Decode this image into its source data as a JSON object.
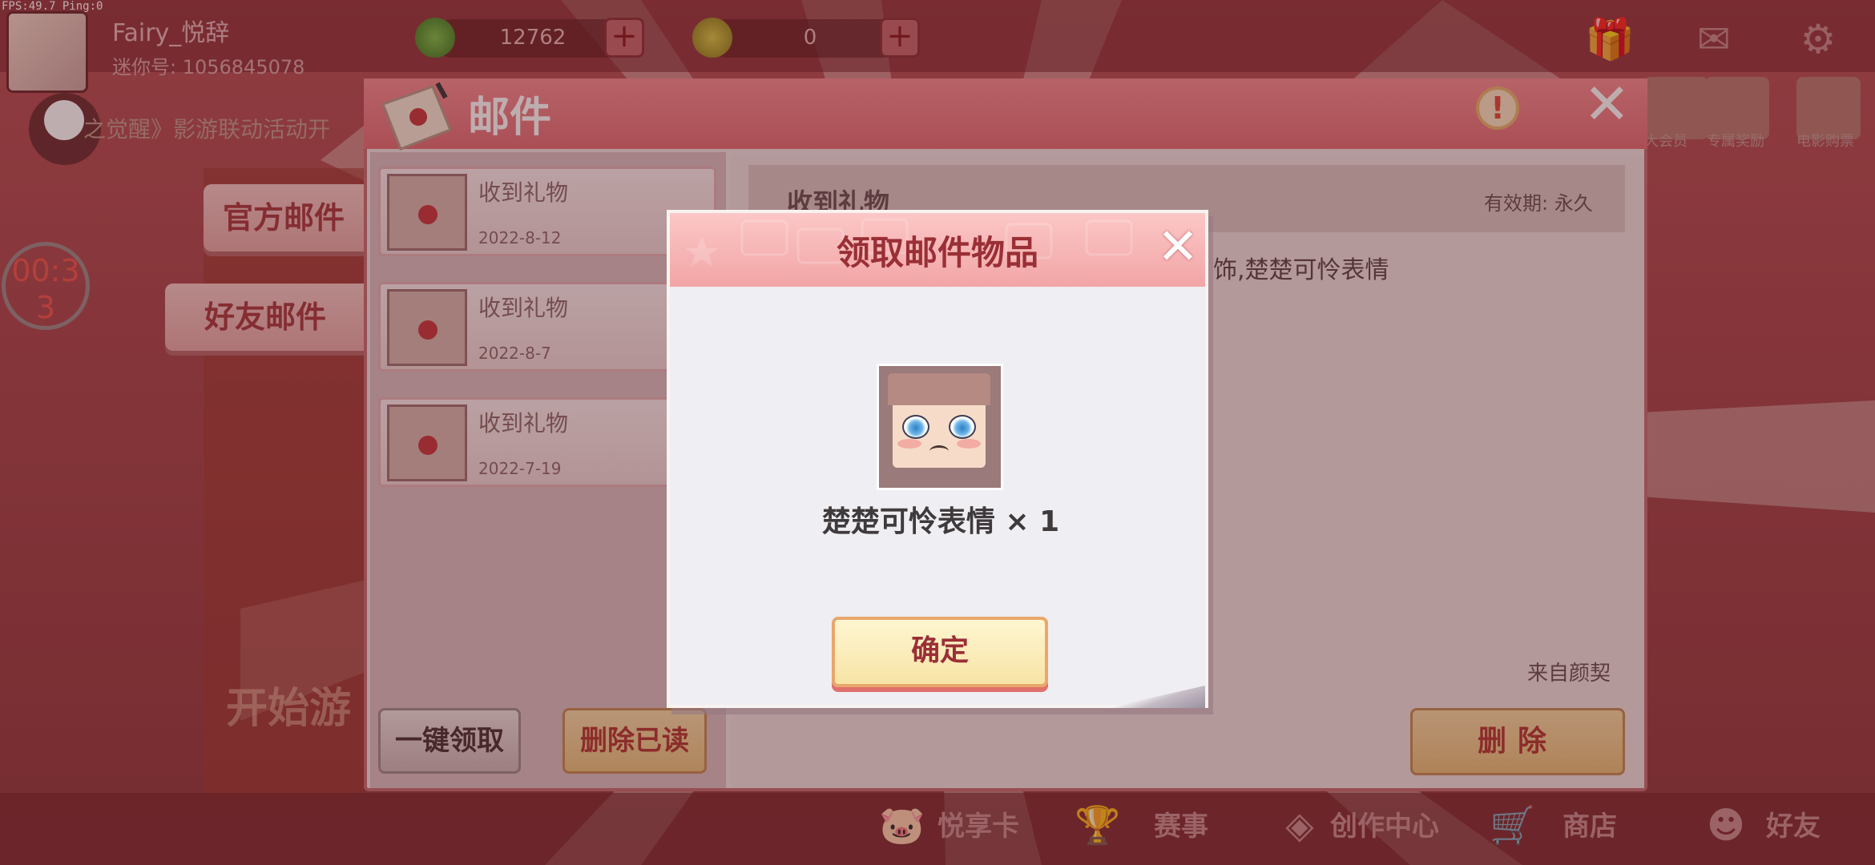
{
  "debug": {
    "fps_text": "FPS:49.7  Ping:0"
  },
  "user": {
    "name": "Fairy_悦辞",
    "id_text": "迷你号: 1056845078"
  },
  "currency": {
    "beans": "12762",
    "coins": "0"
  },
  "news_ticker": "之觉醒》影游联动活动开",
  "timer": {
    "line1": "00:3",
    "line2": "3"
  },
  "start_game": "开始游",
  "side_tabs": [
    {
      "label": "官方邮件"
    },
    {
      "label": "好友邮件"
    }
  ],
  "right_icons": [
    {
      "label": "大会员"
    },
    {
      "label": "专属奖励"
    },
    {
      "label": "电影购票"
    }
  ],
  "mail": {
    "title": "邮件",
    "info_symbol": "!",
    "items": [
      {
        "subject": "收到礼物",
        "date": "2022-8-12"
      },
      {
        "subject": "收到礼物",
        "date": "2022-8-7"
      },
      {
        "subject": "收到礼物",
        "date": "2022-7-19"
      }
    ],
    "collect_all": "一键领取",
    "delete_read": "删除已读",
    "content": {
      "subject": "收到礼物",
      "validity": "有效期: 永久",
      "body_fragment": "饰,楚楚可怜表情",
      "from": "来自颜契"
    },
    "delete": "删除"
  },
  "bottom_nav": [
    {
      "label": "悦享卡"
    },
    {
      "label": "赛事"
    },
    {
      "label": "创作中心"
    },
    {
      "label": "商店"
    },
    {
      "label": "好友"
    }
  ],
  "modal": {
    "title": "领取邮件物品",
    "item_name": "楚楚可怜表情 × 1",
    "confirm": "确定"
  },
  "colors": {
    "accent": "#f2a5a6",
    "title_red": "#9a2f36",
    "button_gold": "#f7e3a5"
  }
}
